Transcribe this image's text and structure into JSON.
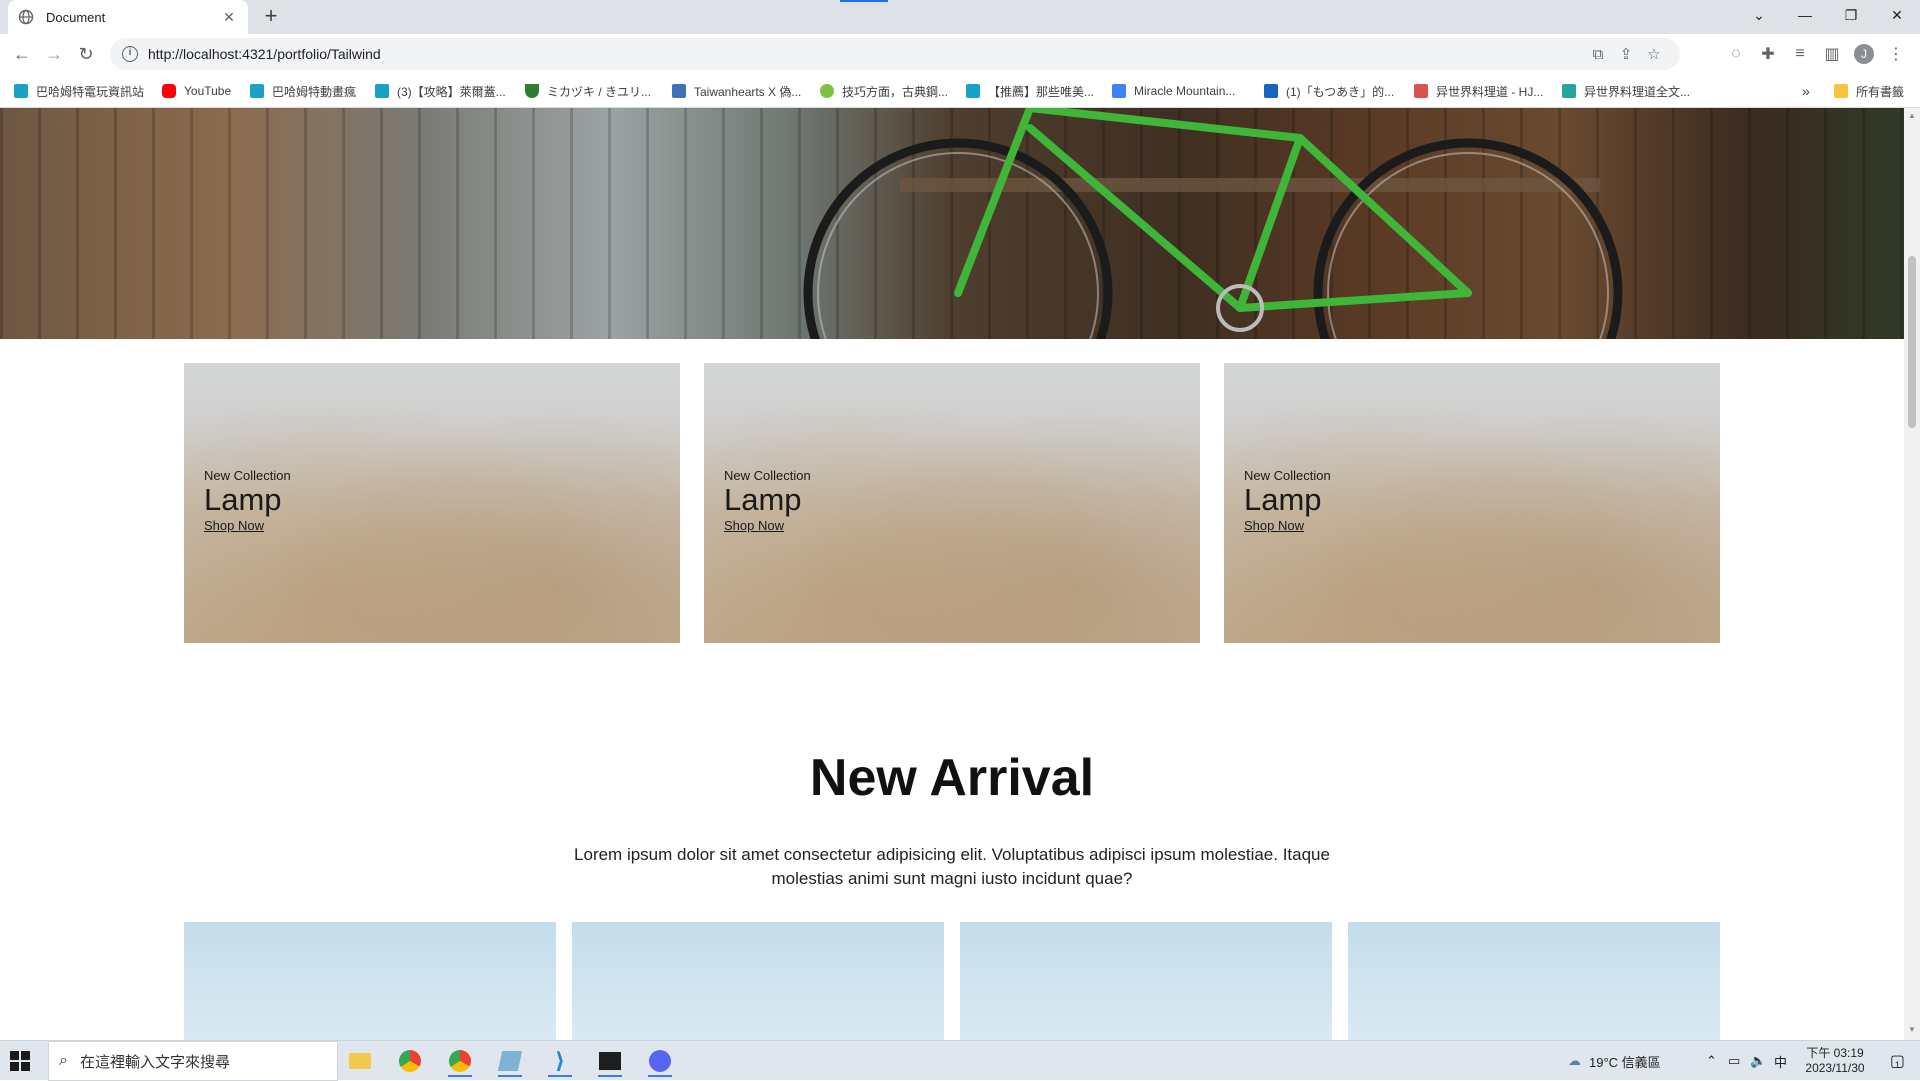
{
  "browser": {
    "tab_title": "Document",
    "url": "http://localhost:4321/portfolio/Tailwind",
    "bookmarks": [
      "巴哈姆特電玩資訊站",
      "YouTube",
      "巴哈姆特動畫瘋",
      "(3)【攻略】萊爾蓋...",
      "ミカヅキ / きユリ...",
      "Taiwanhearts X 偽...",
      "技巧方面，古典鋼...",
      "【推薦】那些唯美...",
      "Miracle Mountain...",
      "(1)「もつあき」的...",
      "异世界料理道 - HJ...",
      "异世界料理道全文..."
    ],
    "bookmarks_overflow": "»",
    "all_bookmarks": "所有書籤"
  },
  "collection_cards": [
    {
      "eyebrow": "New Collection",
      "name": "Lamp",
      "link": "Shop Now"
    },
    {
      "eyebrow": "New Collection",
      "name": "Lamp",
      "link": "Shop Now"
    },
    {
      "eyebrow": "New Collection",
      "name": "Lamp",
      "link": "Shop Now"
    }
  ],
  "new_arrival": {
    "title": "New Arrival",
    "description": "Lorem ipsum dolor sit amet consectetur adipisicing elit. Voluptatibus adipisci ipsum molestiae. Itaque molestias animi sunt magni iusto incidunt quae?"
  },
  "taskbar": {
    "search_placeholder": "在這裡輸入文字來搜尋",
    "weather": "19°C 信義區",
    "ime": "中",
    "time": "下午 03:19",
    "date": "2023/11/30",
    "notification_count": "1"
  },
  "colors": {
    "accent": "#1a73e8",
    "chrome_bg": "#dee1e6",
    "taskbar_bg": "#dfe6ee"
  }
}
